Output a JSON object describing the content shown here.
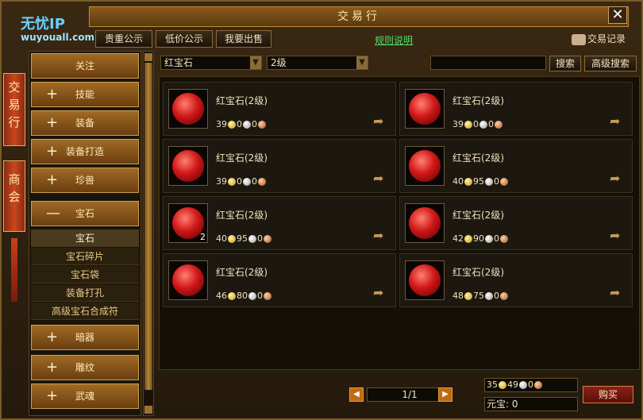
{
  "window": {
    "title": "交易行",
    "close_label": "✕"
  },
  "logo": {
    "line1": "无忧IP",
    "line2": "wuyouall.com"
  },
  "top_tabs": [
    {
      "label": "贵重公示"
    },
    {
      "label": "低价公示"
    },
    {
      "label": "我要出售"
    }
  ],
  "rules_link": "规则说明",
  "trade_record": "交易记录",
  "side_tabs": [
    {
      "label": [
        "交",
        "易",
        "行"
      ]
    },
    {
      "label": [
        "商",
        "会"
      ]
    }
  ],
  "categories": [
    {
      "label": "关注",
      "prefix": ""
    },
    {
      "label": "技能",
      "prefix": "+"
    },
    {
      "label": "装备",
      "prefix": "+"
    },
    {
      "label": "装备打造",
      "prefix": "+"
    },
    {
      "label": "珍兽",
      "prefix": "+"
    },
    {
      "label": "宝石",
      "prefix": "—"
    }
  ],
  "subitems": [
    {
      "label": "宝石",
      "active": true
    },
    {
      "label": "宝石碎片",
      "active": false
    },
    {
      "label": "宝石袋",
      "active": false
    },
    {
      "label": "装备打孔",
      "active": false
    },
    {
      "label": "高级宝石合成符",
      "active": false
    }
  ],
  "categories_bottom": [
    {
      "label": "暗器",
      "prefix": "+"
    },
    {
      "label": "雕纹",
      "prefix": "+"
    },
    {
      "label": "武魂",
      "prefix": "+"
    }
  ],
  "filter": {
    "type_select": "红宝石",
    "level_select": "2级",
    "search_value": "",
    "search_button": "搜索",
    "advanced_button": "高级搜索"
  },
  "items": [
    {
      "name": "红宝石(2级)",
      "gold": "39",
      "silver": "0",
      "copper": "0",
      "qty": ""
    },
    {
      "name": "红宝石(2级)",
      "gold": "39",
      "silver": "0",
      "copper": "0",
      "qty": ""
    },
    {
      "name": "红宝石(2级)",
      "gold": "39",
      "silver": "0",
      "copper": "0",
      "qty": ""
    },
    {
      "name": "红宝石(2级)",
      "gold": "40",
      "silver": "95",
      "copper": "0",
      "qty": ""
    },
    {
      "name": "红宝石(2级)",
      "gold": "40",
      "silver": "95",
      "copper": "0",
      "qty": "2"
    },
    {
      "name": "红宝石(2级)",
      "gold": "42",
      "silver": "90",
      "copper": "0",
      "qty": ""
    },
    {
      "name": "红宝石(2级)",
      "gold": "46",
      "silver": "80",
      "copper": "0",
      "qty": ""
    },
    {
      "name": "红宝石(2级)",
      "gold": "48",
      "silver": "75",
      "copper": "0",
      "qty": ""
    }
  ],
  "pager": {
    "text": "1/1"
  },
  "money": {
    "gold": "35",
    "silver": "49",
    "copper": "0"
  },
  "yuanbao": {
    "label": "元宝:",
    "value": "0"
  },
  "buy_button": "购买"
}
